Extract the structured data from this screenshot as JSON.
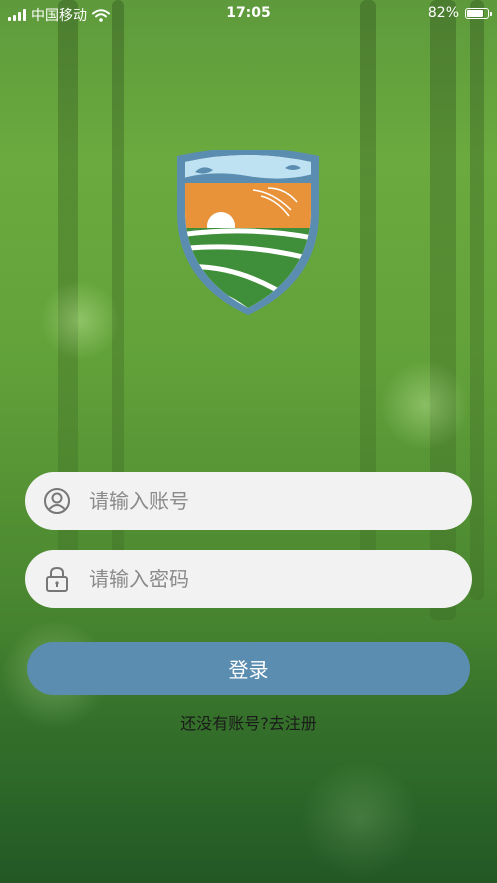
{
  "status_bar": {
    "carrier": "中国移动",
    "time": "17:05",
    "battery_percent": "82%",
    "battery_level": 0.82
  },
  "login": {
    "account_placeholder": "请输入账号",
    "password_placeholder": "请输入密码",
    "submit_label": "登录",
    "register_link": "还没有账号?去注册"
  },
  "icons": {
    "account": "user-circle-icon",
    "password": "lock-icon"
  },
  "colors": {
    "button": "#5b8db1",
    "field": "#f2f2f2",
    "shield_border": "#5b8db1",
    "shield_sky": "#e8933a",
    "shield_field": "#3f8f3a"
  }
}
